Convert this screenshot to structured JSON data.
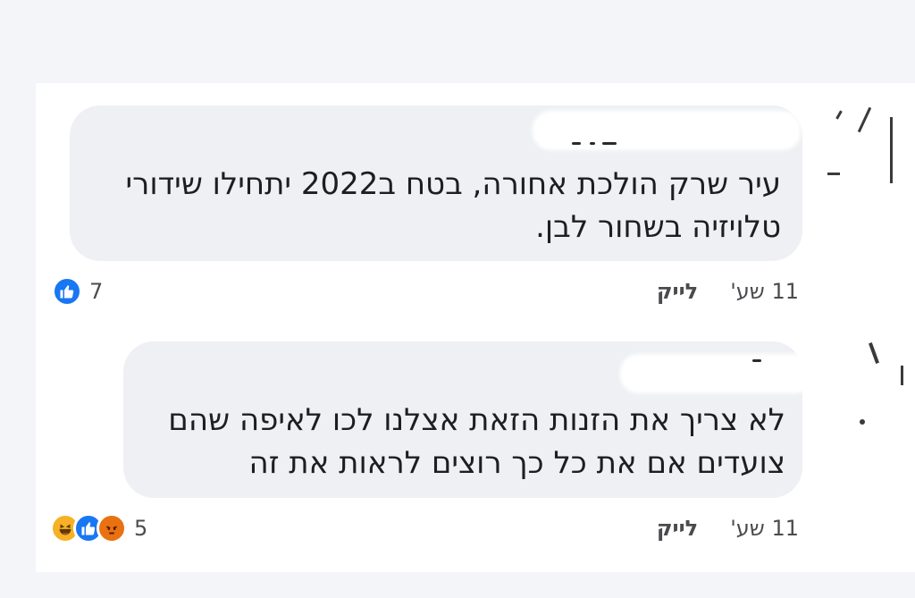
{
  "comments": [
    {
      "text_line1": "עיר שרק הולכת אחורה, בטח ב2022 יתחילו שידורי",
      "text_line2": "טלויזיה בשחור לבן.",
      "time": "11 שע'",
      "like_label": "לייק",
      "reactions": [
        "like-icon"
      ],
      "reaction_count": "7"
    },
    {
      "text_line1": "לא צריך את הזנות הזאת אצלנו לכו לאיפה שהם",
      "text_line2": "צועדים אם את כל כך רוצים לראות את זה",
      "time": "11 שע'",
      "like_label": "לייק",
      "reactions": [
        "haha-icon",
        "like-icon",
        "angry-icon"
      ],
      "reaction_count": "5"
    }
  ],
  "colors": {
    "bubble": "#eef0f4",
    "like": "#1877f2",
    "haha": "#f7b125",
    "angry": "#e9710f",
    "meta_text": "#65676b"
  }
}
